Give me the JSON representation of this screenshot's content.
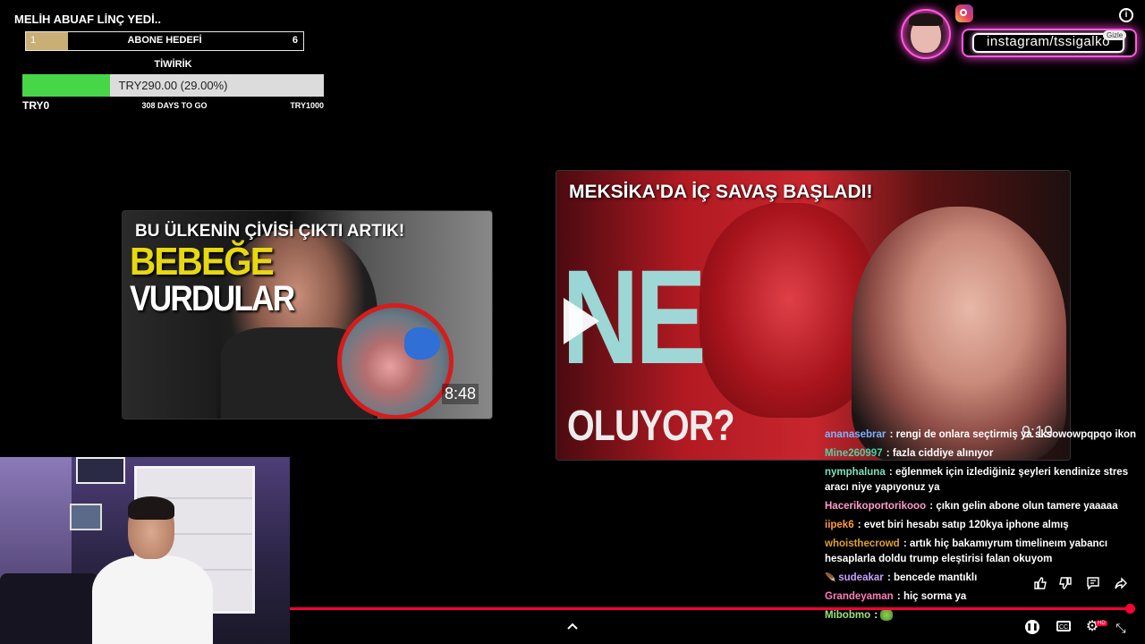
{
  "stream_title": "MELİH ABUAF LİNÇ YEDİ..",
  "sub_goal": {
    "current": "1",
    "label": "ABONE HEDEFİ",
    "target": "6",
    "progress": 0.15
  },
  "donation": {
    "title": "TİWİRİK",
    "amount": "TRY290.00 (29.00%)",
    "progress": 0.29,
    "min": "TRY0",
    "days": "308 DAYS TO GO",
    "max": "TRY1000"
  },
  "instagram": {
    "handle": "instagram/tssigalko",
    "chip": "Gizle"
  },
  "video_1": {
    "headline": "BU ÜLKENİN ÇİVİSİ ÇIKTI ARTIK!",
    "big_text_1": "BEBEĞE",
    "big_text_2": "VURDULAR",
    "duration": "8:48"
  },
  "video_2": {
    "headline": "MEKSİKA'DA İÇ SAVAŞ BAŞLADI!",
    "big_text": "NE",
    "sub_text": "OLUYOR?",
    "duration": "9:19"
  },
  "chat": [
    {
      "user": "ananasebrar",
      "color": "#7fb0ff",
      "text": "rengi de onlara seçtirmiş ya sksowowpqpqo ikon"
    },
    {
      "user": "Mine260997",
      "color": "#4fd1a8",
      "text": "fazla ciddiye alınıyor"
    },
    {
      "user": "nymphaluna",
      "color": "#7fe0c0",
      "text": "eğlenmek için izlediğiniz şeyleri kendinize stres aracı niye yapıyonuz ya"
    },
    {
      "user": "Hacerikoportorikooo",
      "color": "#ff9ccd",
      "text": "çıkın gelin abone olun tamere yaaaaa"
    },
    {
      "user": "iipek6",
      "color": "#ff9a3c",
      "text": "evet biri hesabı satıp 120kya iphone almış"
    },
    {
      "user": "whoisthecrowd",
      "color": "#e0a030",
      "text": "artık hiç bakamıyrum timelineım yabancı hesaplarla doldu trump eleştirisi falan okuyom"
    },
    {
      "user": "sudeakar",
      "color": "#c8a0ff",
      "text": "bencede mantıklı",
      "badge": "feather"
    },
    {
      "user": "Grandeyaman",
      "color": "#ff7bbd",
      "text": "hiç sorma ya"
    },
    {
      "user": "Mibobmo",
      "color": "#9be37a",
      "text": "",
      "emote": "frog-emote"
    }
  ],
  "player": {
    "progress": 0.99,
    "accent": "#ff0033"
  },
  "icons": [
    "info-icon",
    "instagram-icon",
    "play-icon",
    "chevron-up-icon",
    "like-icon",
    "dislike-icon",
    "comment-icon",
    "share-icon",
    "pause-icon",
    "captions-icon",
    "settings-icon",
    "fullscreen-exit-icon"
  ]
}
